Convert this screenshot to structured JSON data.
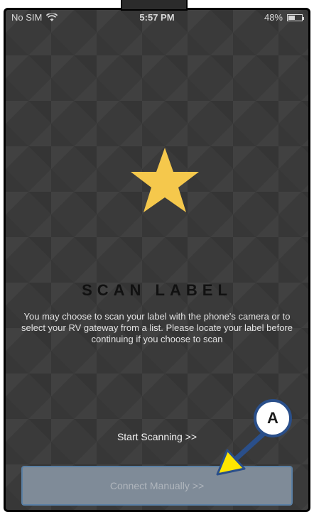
{
  "status_bar": {
    "carrier": "No SIM",
    "time": "5:57 PM",
    "battery_percent": "48%",
    "battery_level": 0.48,
    "wifi_icon": "wifi-icon"
  },
  "main": {
    "title": "SCAN LABEL",
    "description": "You may choose to scan your label with the phone's camera or to select your RV gateway from a list. Please locate your label before continuing if you choose to scan",
    "star_color": "#F5C84C",
    "start_scanning_label": "Start Scanning >>",
    "connect_manually_label": "Connect Manually >>"
  },
  "callout": {
    "label": "A",
    "arrow_color": "#FFE600"
  }
}
